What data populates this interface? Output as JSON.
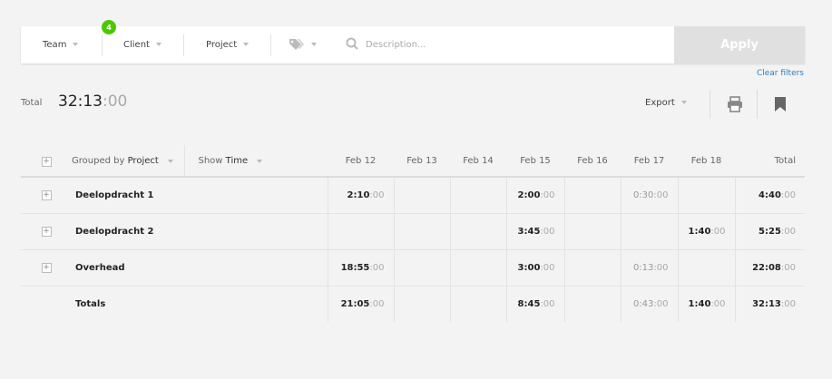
{
  "filters": {
    "team": {
      "label": "Team",
      "badge": "4"
    },
    "client": {
      "label": "Client"
    },
    "project": {
      "label": "Project"
    },
    "description_placeholder": "Description...",
    "apply_label": "Apply",
    "clear_label": "Clear filters"
  },
  "summary": {
    "total_label": "Total",
    "total_main": "32:13",
    "total_sec": ":00"
  },
  "toolbar": {
    "export_label": "Export"
  },
  "table": {
    "group_prefix": "Grouped by",
    "group_value": "Project",
    "show_prefix": "Show",
    "show_value": "Time",
    "columns": [
      "Feb 12",
      "Feb 13",
      "Feb 14",
      "Feb 15",
      "Feb 16",
      "Feb 17",
      "Feb 18",
      "Total"
    ],
    "rows": [
      {
        "name": "Deelopdracht 1",
        "cells": [
          [
            "2:10",
            ":00"
          ],
          null,
          null,
          [
            "2:00",
            ":00"
          ],
          null,
          [
            "0:30",
            ":00"
          ],
          null,
          [
            "4:40",
            ":00"
          ]
        ]
      },
      {
        "name": "Deelopdracht 2",
        "cells": [
          null,
          null,
          null,
          [
            "3:45",
            ":00"
          ],
          null,
          null,
          [
            "1:40",
            ":00"
          ],
          [
            "5:25",
            ":00"
          ]
        ]
      },
      {
        "name": "Overhead",
        "cells": [
          [
            "18:55",
            ":00"
          ],
          null,
          null,
          [
            "3:00",
            ":00"
          ],
          null,
          [
            "0:13",
            ":00"
          ],
          null,
          [
            "22:08",
            ":00"
          ]
        ]
      }
    ],
    "totals": {
      "name": "Totals",
      "cells": [
        [
          "21:05",
          ":00"
        ],
        null,
        null,
        [
          "8:45",
          ":00"
        ],
        null,
        [
          "0:43",
          ":00"
        ],
        [
          "1:40",
          ":00"
        ],
        [
          "32:13",
          ":00"
        ]
      ]
    }
  },
  "colors": {
    "accent_link": "#2a7dbf",
    "badge_green": "#4bc800",
    "apply_disabled": "#e0e0e0"
  }
}
